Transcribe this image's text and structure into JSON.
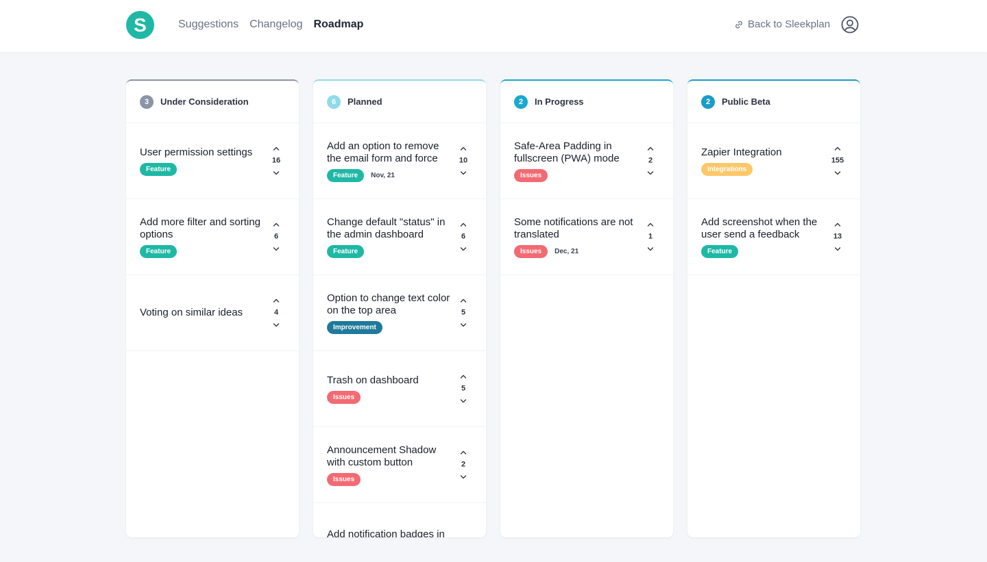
{
  "header": {
    "logo_letter": "S",
    "nav": [
      "Suggestions",
      "Changelog",
      "Roadmap"
    ],
    "active_nav": "Roadmap",
    "back_label": "Back to Sleekplan"
  },
  "colors": {
    "brand": "#1fb8a5",
    "feature": "#1fb8a5",
    "improvement": "#1f7a9a",
    "issues": "#f26a73",
    "integrations": "#fdc86a"
  },
  "columns": [
    {
      "title": "Under Consideration",
      "count": "3",
      "accent": "#8b95a5",
      "cards": [
        {
          "title": "User permission settings",
          "tag": "Feature",
          "tag_color": "#1fb8a5",
          "date": "",
          "votes": "16"
        },
        {
          "title": "Add more filter and sorting options",
          "tag": "Feature",
          "tag_color": "#1fb8a5",
          "date": "",
          "votes": "6"
        },
        {
          "title": "Voting on similar ideas",
          "tag": "",
          "tag_color": "",
          "date": "",
          "votes": "4"
        }
      ]
    },
    {
      "title": "Planned",
      "count": "6",
      "accent": "#8fdbea",
      "cards": [
        {
          "title": "Add an option to remove the email form and force",
          "tag": "Feature",
          "tag_color": "#1fb8a5",
          "date": "Nov, 21",
          "votes": "10"
        },
        {
          "title": "Change default \"status\" in the admin dashboard",
          "tag": "Feature",
          "tag_color": "#1fb8a5",
          "date": "",
          "votes": "6"
        },
        {
          "title": "Option to change text color on the top area",
          "tag": "Improvement",
          "tag_color": "#1f7a9a",
          "date": "",
          "votes": "5"
        },
        {
          "title": "Trash on dashboard",
          "tag": "Issues",
          "tag_color": "#f26a73",
          "date": "",
          "votes": "5"
        },
        {
          "title": "Announcement Shadow with custom button",
          "tag": "Issues",
          "tag_color": "#f26a73",
          "date": "",
          "votes": "2"
        },
        {
          "title": "Add notification badges in New Customized",
          "tag": "",
          "tag_color": "",
          "date": "",
          "votes": ""
        }
      ]
    },
    {
      "title": "In Progress",
      "count": "2",
      "accent": "#1aa8d0",
      "cards": [
        {
          "title": "Safe-Area Padding in fullscreen (PWA) mode",
          "tag": "Issues",
          "tag_color": "#f26a73",
          "date": "",
          "votes": "2"
        },
        {
          "title": "Some notifications are not translated",
          "tag": "Issues",
          "tag_color": "#f26a73",
          "date": "Dec, 21",
          "votes": "1"
        }
      ]
    },
    {
      "title": "Public Beta",
      "count": "2",
      "accent": "#1a9bc9",
      "cards": [
        {
          "title": "Zapier Integration",
          "tag": "Integrations",
          "tag_color": "#fdc86a",
          "date": "",
          "votes": "155"
        },
        {
          "title": "Add screenshot when the user send a feedback",
          "tag": "Feature",
          "tag_color": "#1fb8a5",
          "date": "",
          "votes": "13"
        }
      ]
    }
  ]
}
